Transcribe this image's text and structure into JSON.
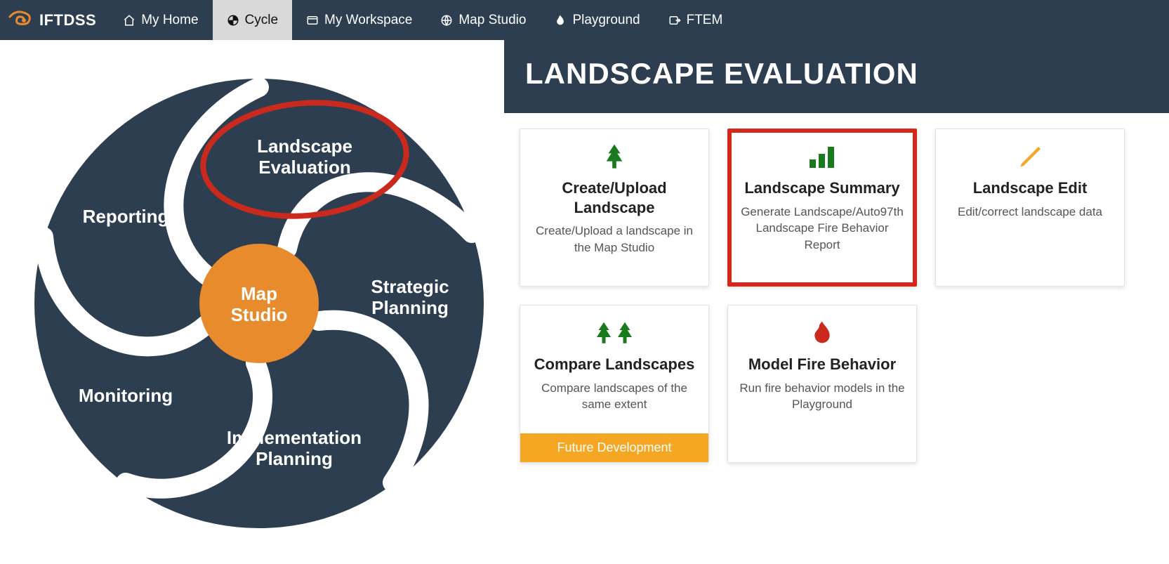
{
  "brand": {
    "name": "IFTDSS"
  },
  "nav": {
    "myHome": "My Home",
    "cycle": "Cycle",
    "workspace": "My Workspace",
    "mapStudio": "Map Studio",
    "playground": "Playground",
    "ftem": "FTEM"
  },
  "page": {
    "title": "LANDSCAPE EVALUATION"
  },
  "wheel": {
    "center": {
      "line1": "Map",
      "line2": "Studio"
    },
    "segments": {
      "landscapeEvaluation": {
        "line1": "Landscape",
        "line2": "Evaluation"
      },
      "strategicPlanning": {
        "line1": "Strategic",
        "line2": "Planning"
      },
      "implementationPlanning": {
        "line1": "Implementation",
        "line2": "Planning"
      },
      "monitoring": {
        "line1": "Monitoring"
      },
      "reporting": {
        "line1": "Reporting"
      }
    }
  },
  "cards": {
    "createUpload": {
      "title_line1": "Create/Upload",
      "title_line2": "Landscape",
      "desc": "Create/Upload a landscape in the Map Studio"
    },
    "landscapeSummary": {
      "title": "Landscape Summary",
      "desc": "Generate Landscape/Auto97th Landscape Fire Behavior Report"
    },
    "landscapeEdit": {
      "title": "Landscape Edit",
      "desc": "Edit/correct landscape data"
    },
    "compareLandscapes": {
      "title": "Compare Landscapes",
      "desc": "Compare landscapes of the same extent",
      "badge": "Future Development"
    },
    "modelFire": {
      "title": "Model Fire Behavior",
      "desc": "Run fire behavior models in the Playground"
    }
  }
}
